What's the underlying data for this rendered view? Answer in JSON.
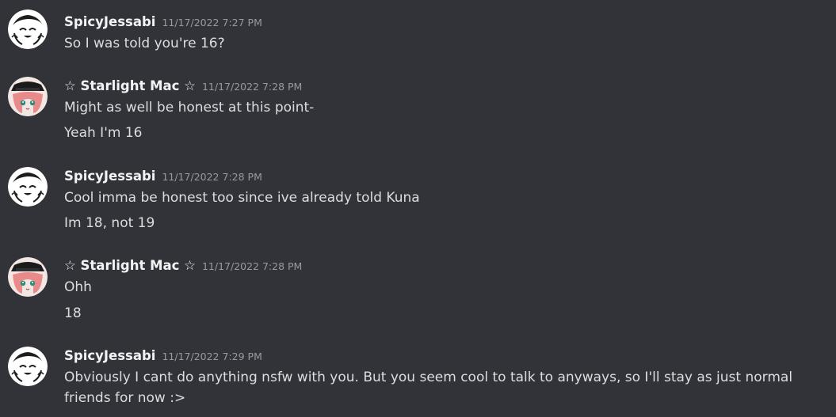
{
  "messages": [
    {
      "author": "SpicyJessabi",
      "avatar_icon": "white-sketch-avatar",
      "timestamp": "11/17/2022 7:27 PM",
      "lines": [
        "So I was told you're 16?"
      ]
    },
    {
      "author": "☆ Starlight Mac ☆",
      "avatar_icon": "pink-hair-hat-avatar",
      "timestamp": "11/17/2022 7:28 PM",
      "lines": [
        "Might as well be honest at this point-",
        "Yeah I'm 16"
      ]
    },
    {
      "author": "SpicyJessabi",
      "avatar_icon": "white-sketch-avatar",
      "timestamp": "11/17/2022 7:28 PM",
      "lines": [
        "Cool imma be honest too since ive already told Kuna",
        "Im 18, not 19"
      ]
    },
    {
      "author": "☆ Starlight Mac ☆",
      "avatar_icon": "pink-hair-hat-avatar",
      "timestamp": "11/17/2022 7:28 PM",
      "lines": [
        "Ohh",
        "18"
      ]
    },
    {
      "author": "SpicyJessabi",
      "avatar_icon": "white-sketch-avatar",
      "timestamp": "11/17/2022 7:29 PM",
      "lines": [
        "Obviously I cant do anything nsfw with you. But you seem cool to talk to anyways, so I'll stay as just normal friends for now :>"
      ]
    }
  ],
  "colors": {
    "background": "#313338",
    "username": "#f2f3f5",
    "timestamp": "#949ba4",
    "text": "#dbdee1"
  }
}
